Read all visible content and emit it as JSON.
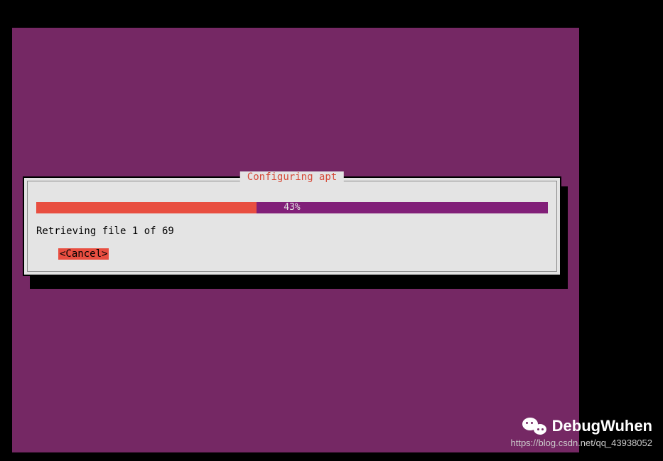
{
  "dialog": {
    "title": "Configuring apt",
    "progress_percent": 43,
    "progress_label": "43%",
    "status_text": "Retrieving file 1 of 69",
    "cancel_label": "<Cancel>"
  },
  "watermark": {
    "name": "DebugWuhen",
    "url": "https://blog.csdn.net/qq_43938052"
  },
  "colors": {
    "background_purple": "#752864",
    "accent_red": "#e84e40",
    "progress_purple": "#811f78",
    "dialog_bg": "#e4e4e4"
  }
}
